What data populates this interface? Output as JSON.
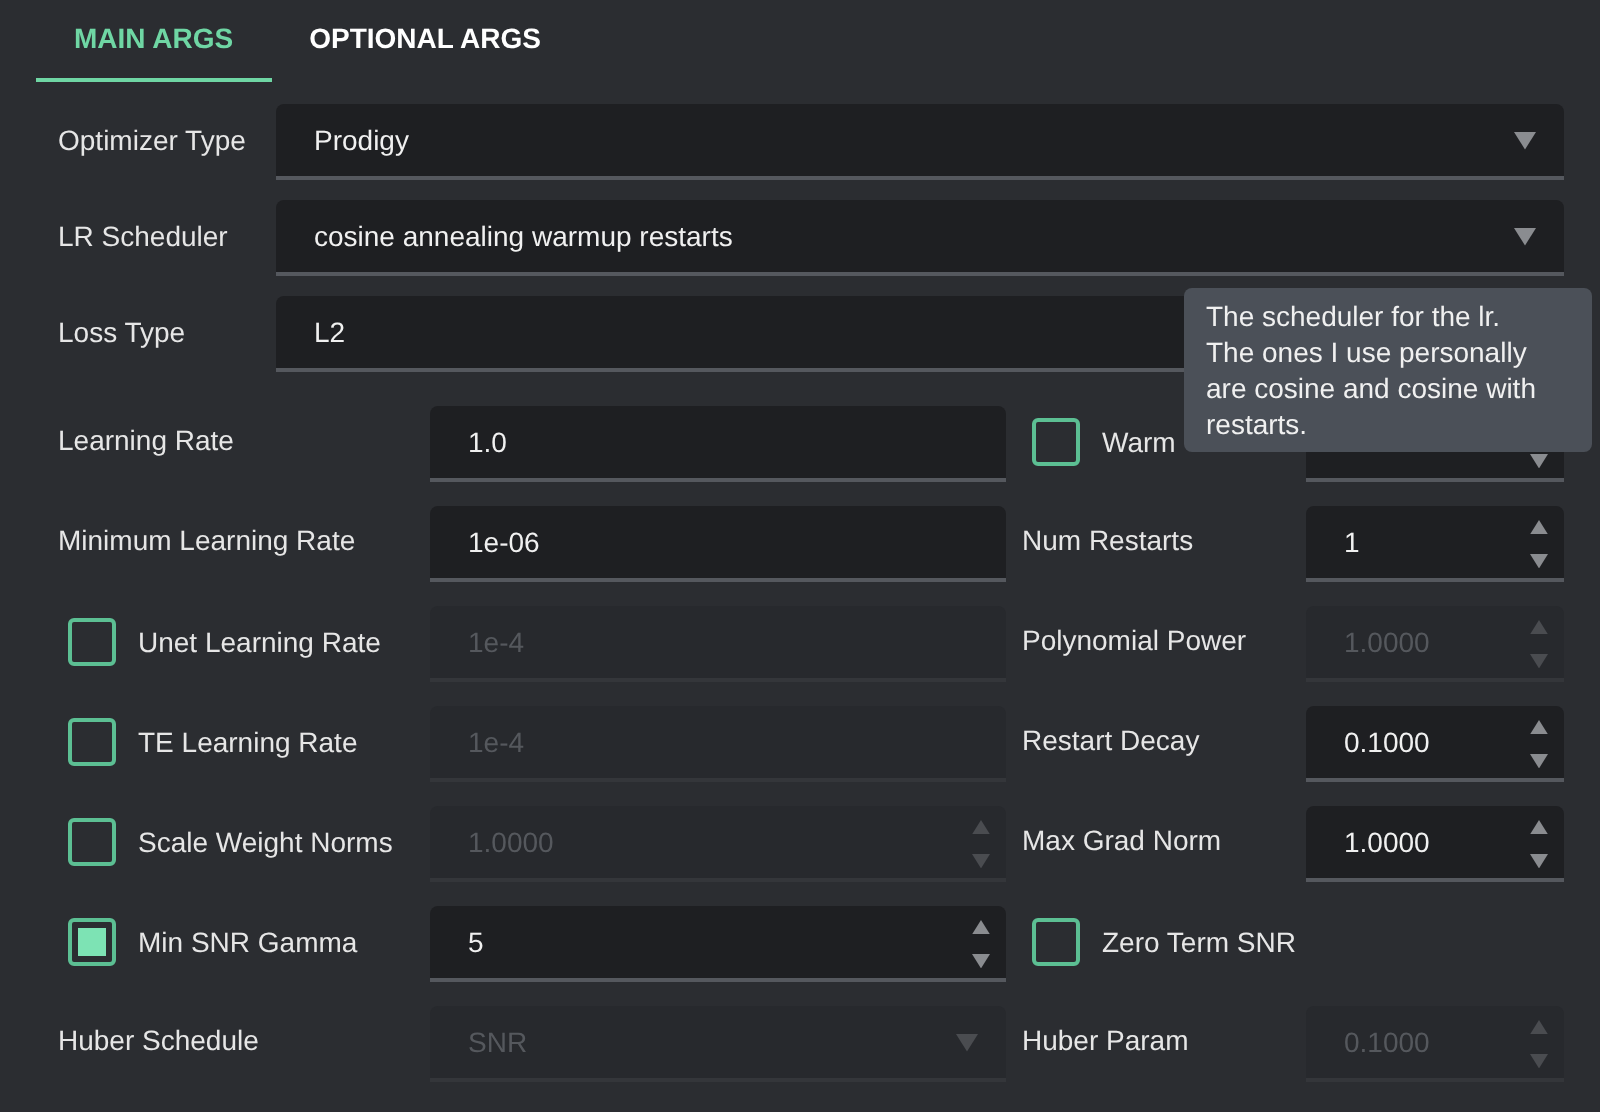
{
  "tabs": [
    {
      "label": "MAIN ARGS",
      "selected": true
    },
    {
      "label": "OPTIONAL ARGS",
      "selected": false
    }
  ],
  "wide_fields": [
    {
      "label": "Optimizer Type",
      "value": "Prodigy"
    },
    {
      "label": "LR Scheduler",
      "value": "cosine annealing warmup restarts"
    },
    {
      "label": "Loss Type",
      "value": "L2"
    }
  ],
  "left_fields": [
    {
      "label": "Learning Rate",
      "kind": "text",
      "disabled": false,
      "value": "1.0"
    },
    {
      "label": "Minimum Learning Rate",
      "kind": "text",
      "disabled": false,
      "value": "1e-06"
    },
    {
      "label": "Unet Learning Rate",
      "checked": false,
      "kind": "text",
      "disabled": true,
      "value": "1e-4"
    },
    {
      "label": "TE Learning Rate",
      "checked": false,
      "kind": "text",
      "disabled": true,
      "value": "1e-4"
    },
    {
      "label": "Scale Weight Norms",
      "checked": false,
      "kind": "spin",
      "disabled": true,
      "value": "1.0000"
    },
    {
      "label": "Min SNR Gamma",
      "checked": true,
      "kind": "spin",
      "disabled": false,
      "value": "5"
    },
    {
      "label": "Huber Schedule",
      "kind": "dropdown",
      "disabled": true,
      "value": "SNR"
    }
  ],
  "right_fields": [
    {
      "label": "Warm",
      "checked": false,
      "kind": "spin",
      "disabled": false
    },
    {
      "label": "Num Restarts",
      "kind": "spin",
      "disabled": false,
      "value": "1"
    },
    {
      "label": "Polynomial Power",
      "kind": "spin",
      "disabled": true,
      "value": "1.0000"
    },
    {
      "label": "Restart Decay",
      "kind": "spin",
      "disabled": false,
      "value": "0.1000"
    },
    {
      "label": "Max Grad Norm",
      "kind": "spin",
      "disabled": false,
      "value": "1.0000"
    },
    {
      "label": "Zero Term SNR",
      "checked": false,
      "kind": "none"
    },
    {
      "label": "Huber Param",
      "kind": "spin",
      "disabled": true,
      "value": "0.1000"
    }
  ],
  "tooltip": {
    "text": "The scheduler for the lr. The ones I use personally are cosine and cosine with restarts."
  }
}
